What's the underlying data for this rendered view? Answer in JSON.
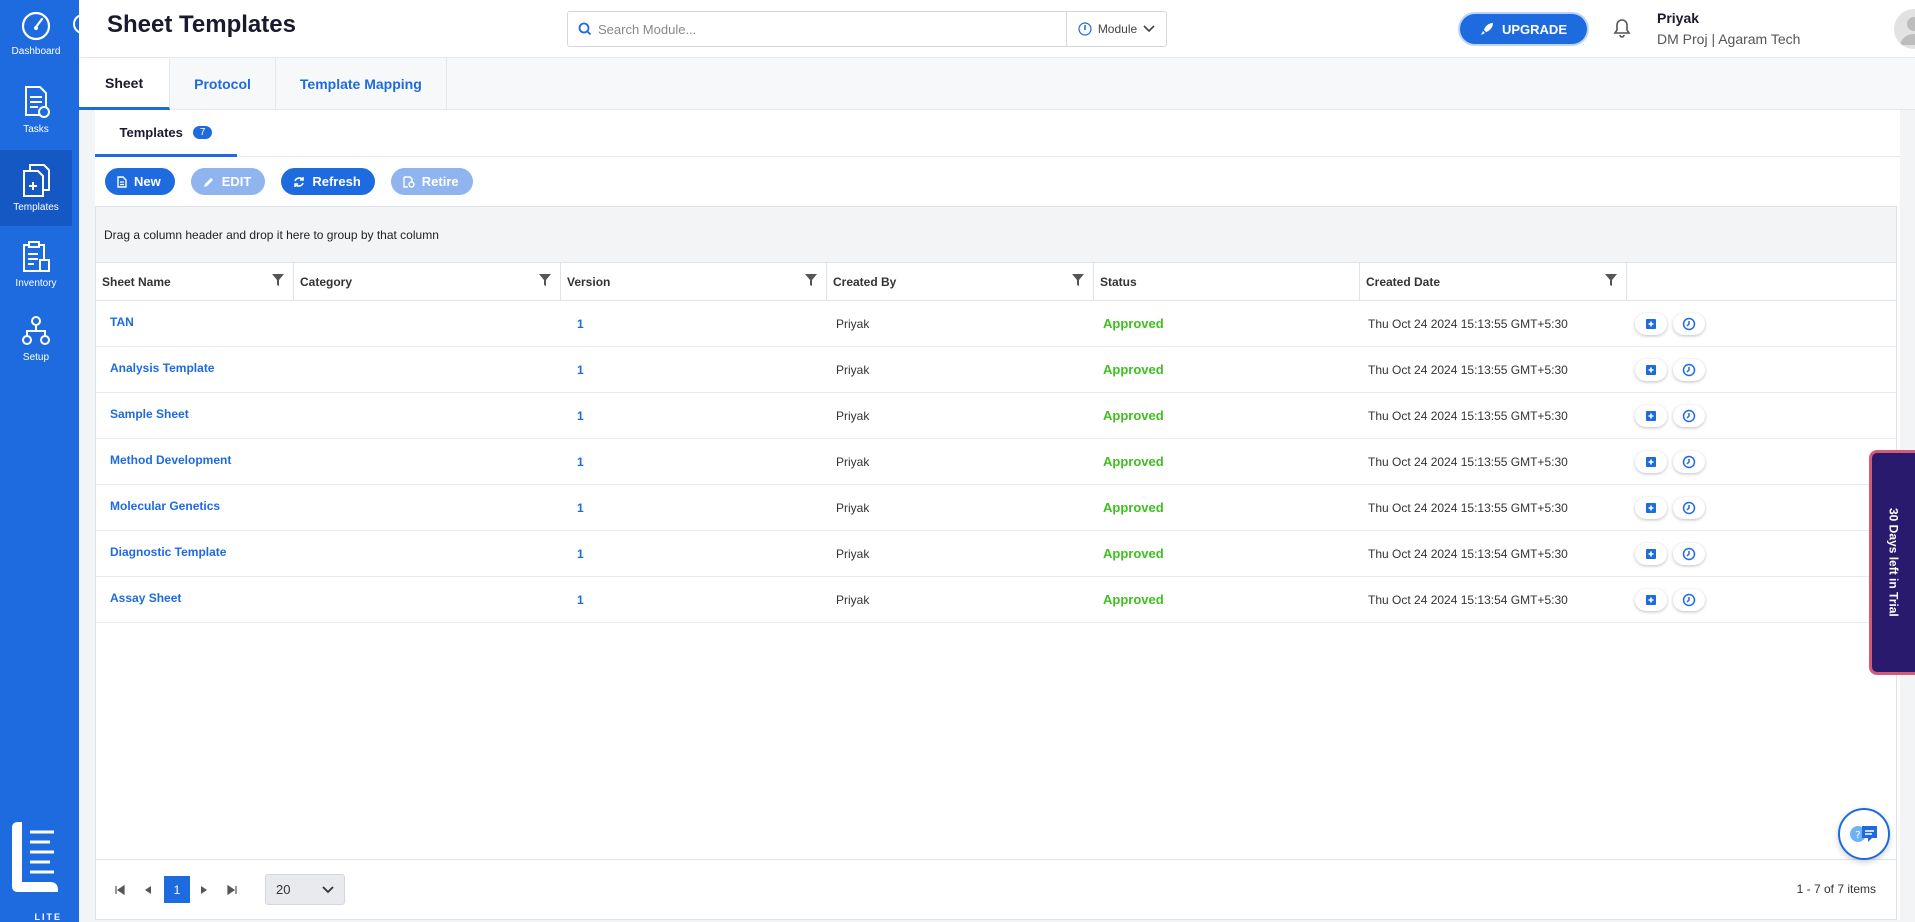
{
  "sidebar": {
    "items": [
      {
        "label": "Dashboard",
        "icon": "gauge-icon"
      },
      {
        "label": "Tasks",
        "icon": "document-icon"
      },
      {
        "label": "Templates",
        "icon": "template-icon",
        "active": true
      },
      {
        "label": "Inventory",
        "icon": "clipboard-icon"
      },
      {
        "label": "Setup",
        "icon": "network-icon"
      }
    ],
    "logo_text": "LITE"
  },
  "header": {
    "title": "Sheet Templates",
    "search_placeholder": "Search Module...",
    "module_label": "Module",
    "upgrade_label": "UPGRADE",
    "user_name": "Priyak",
    "user_org": "DM Proj | Agaram Tech"
  },
  "main_tabs": [
    {
      "label": "Sheet",
      "active": true
    },
    {
      "label": "Protocol"
    },
    {
      "label": "Template Mapping"
    }
  ],
  "sub_tab": {
    "label": "Templates",
    "count": "7"
  },
  "toolbar": {
    "new_label": "New",
    "edit_label": "EDIT",
    "refresh_label": "Refresh",
    "retire_label": "Retire"
  },
  "grid": {
    "group_hint": "Drag a column header and drop it here to group by that column",
    "columns": [
      "Sheet Name",
      "Category",
      "Version",
      "Created By",
      "Status",
      "Created Date"
    ],
    "rows": [
      {
        "name": "TAN",
        "category": "",
        "version": "1",
        "created_by": "Priyak",
        "status": "Approved",
        "date": "Thu Oct 24 2024 15:13:55 GMT+5:30"
      },
      {
        "name": "Analysis Template",
        "category": "",
        "version": "1",
        "created_by": "Priyak",
        "status": "Approved",
        "date": "Thu Oct 24 2024 15:13:55 GMT+5:30"
      },
      {
        "name": "Sample Sheet",
        "category": "",
        "version": "1",
        "created_by": "Priyak",
        "status": "Approved",
        "date": "Thu Oct 24 2024 15:13:55 GMT+5:30"
      },
      {
        "name": "Method Development",
        "category": "",
        "version": "1",
        "created_by": "Priyak",
        "status": "Approved",
        "date": "Thu Oct 24 2024 15:13:55 GMT+5:30"
      },
      {
        "name": "Molecular Genetics",
        "category": "",
        "version": "1",
        "created_by": "Priyak",
        "status": "Approved",
        "date": "Thu Oct 24 2024 15:13:55 GMT+5:30"
      },
      {
        "name": "Diagnostic Template",
        "category": "",
        "version": "1",
        "created_by": "Priyak",
        "status": "Approved",
        "date": "Thu Oct 24 2024 15:13:54 GMT+5:30"
      },
      {
        "name": "Assay Sheet",
        "category": "",
        "version": "1",
        "created_by": "Priyak",
        "status": "Approved",
        "date": "Thu Oct 24 2024 15:13:54 GMT+5:30"
      }
    ]
  },
  "pager": {
    "current_page": "1",
    "page_size": "20",
    "info": "1 - 7 of 7 items"
  },
  "trial_banner": "30 Days left in Trial",
  "colors": {
    "brand": "#1e6be0",
    "approved": "#3fbf20",
    "trial": "#2a1a6e"
  }
}
